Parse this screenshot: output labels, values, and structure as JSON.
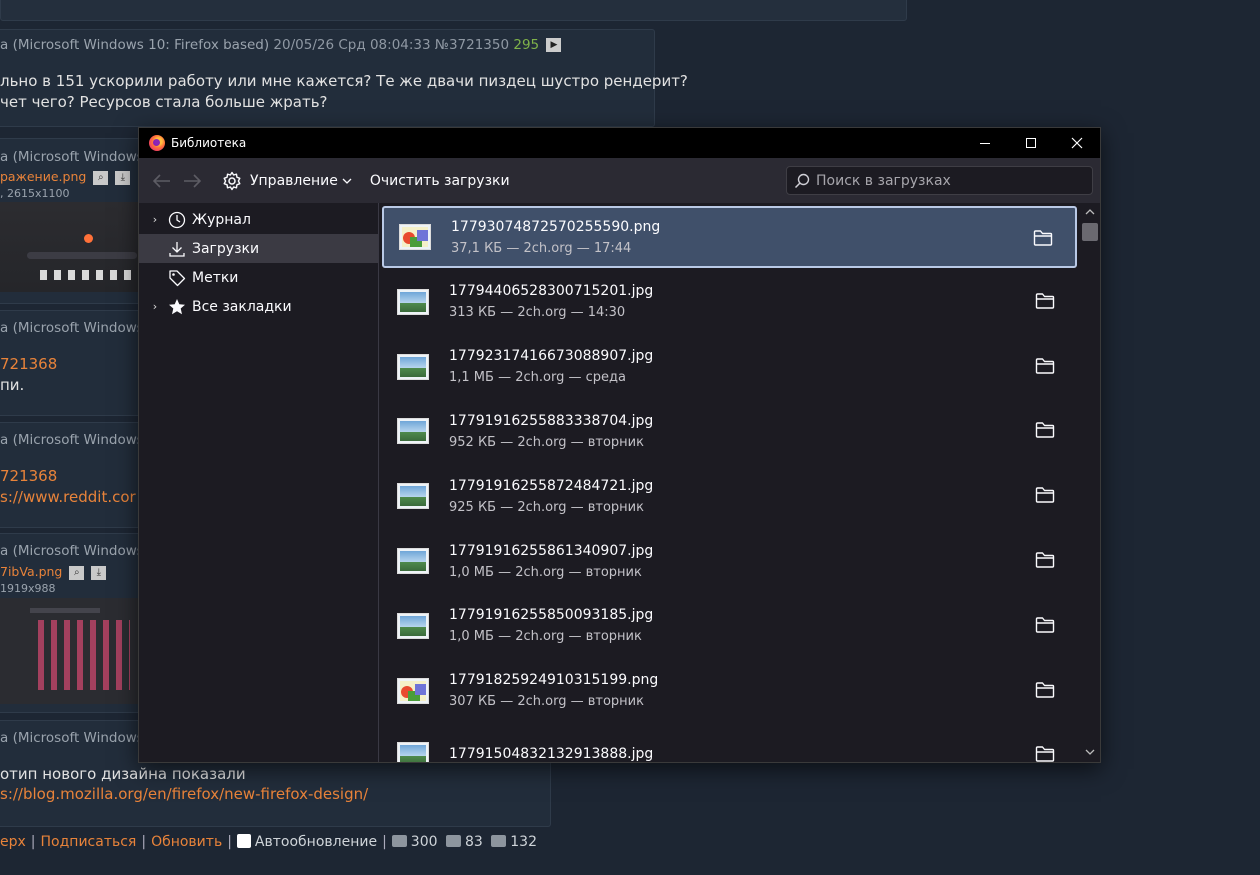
{
  "board": {
    "post1": {
      "author": "а (Microsoft Windows 10: Firefox based)",
      "date": "20/05/26 Срд 08:04:33",
      "number": "№3721350",
      "count": "295",
      "line1": "льно в 151 ускорили работу или мне кажется? Те же двачи пиздец шустро рендерит?",
      "line2": "чет чего? Ресурсов стала больше жрать?"
    },
    "post2": {
      "author": "а (Microsoft Windows",
      "file": "ражение.png",
      "filemeta": ", 2615x1100"
    },
    "post3": {
      "author": "а (Microsoft Windows",
      "reply": "721368",
      "text": "пи."
    },
    "post4": {
      "author": "а (Microsoft Windows",
      "reply": "721368",
      "link": "s://www.reddit.cor"
    },
    "post5": {
      "author": "а (Microsoft Windows",
      "file": "7ibVa.png",
      "filemeta": "1919x988"
    },
    "post6": {
      "author": "а (Microsoft Windows",
      "text": "отип нового дизайна показали",
      "link": "s://blog.mozilla.org/en/firefox/new-firefox-design/"
    },
    "footer": {
      "up": "ерх",
      "subscribe": "Подписаться",
      "refresh": "Обновить",
      "autorefresh": "Автообновление",
      "posts": "300",
      "files": "83",
      "users": "132"
    }
  },
  "window": {
    "title": "Библиотека",
    "toolbar": {
      "manage": "Управление",
      "clear": "Очистить загрузки",
      "search_placeholder": "Поиск в загрузках"
    },
    "sidebar": [
      {
        "label": "Журнал",
        "icon": "clock-icon"
      },
      {
        "label": "Загрузки",
        "icon": "download-icon"
      },
      {
        "label": "Метки",
        "icon": "tag-icon"
      },
      {
        "label": "Все закладки",
        "icon": "star-icon"
      }
    ],
    "downloads": [
      {
        "name": "17793074872570255590.png",
        "meta": "37,1 КБ — 2ch.org — 17:44",
        "type": "png"
      },
      {
        "name": "17794406528300715201.jpg",
        "meta": "313 КБ — 2ch.org — 14:30",
        "type": "jpg"
      },
      {
        "name": "17792317416673088907.jpg",
        "meta": "1,1 МБ — 2ch.org — среда",
        "type": "jpg"
      },
      {
        "name": "17791916255883338704.jpg",
        "meta": "952 КБ — 2ch.org — вторник",
        "type": "jpg"
      },
      {
        "name": "17791916255872484721.jpg",
        "meta": "925 КБ — 2ch.org — вторник",
        "type": "jpg"
      },
      {
        "name": "17791916255861340907.jpg",
        "meta": "1,0 МБ — 2ch.org — вторник",
        "type": "jpg"
      },
      {
        "name": "17791916255850093185.jpg",
        "meta": "1,0 МБ — 2ch.org — вторник",
        "type": "jpg"
      },
      {
        "name": "17791825924910315199.png",
        "meta": "307 КБ — 2ch.org — вторник",
        "type": "png"
      },
      {
        "name": "17791504832132913888.jpg",
        "meta": "",
        "type": "jpg"
      }
    ]
  }
}
